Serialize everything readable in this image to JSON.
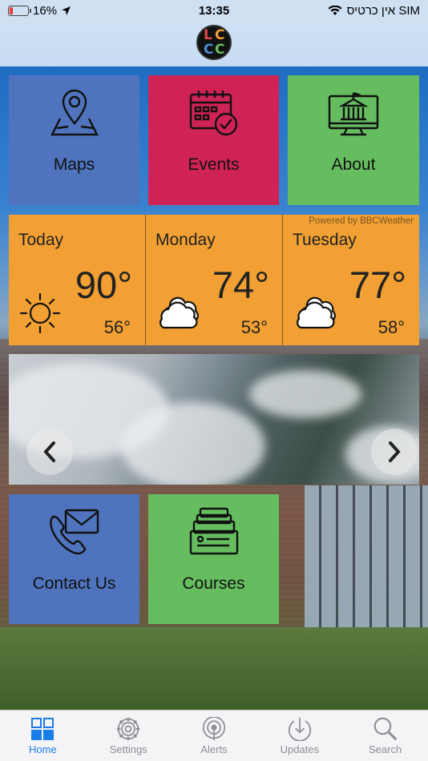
{
  "status_bar": {
    "battery": "16%",
    "battery_level": 0.16,
    "time": "13:35",
    "carrier": "אין כרטיס SIM"
  },
  "header": {
    "logo_letters": [
      "L",
      "C",
      "C",
      "C"
    ]
  },
  "tiles": {
    "maps": "Maps",
    "events": "Events",
    "about": "About",
    "contact": "Contact Us",
    "courses": "Courses"
  },
  "weather": {
    "powered_by": "Powered by BBCWeather",
    "days": [
      {
        "name": "Today",
        "high": "90°",
        "low": "56°",
        "icon": "sun-icon"
      },
      {
        "name": "Monday",
        "high": "74°",
        "low": "53°",
        "icon": "cloud-icon"
      },
      {
        "name": "Tuesday",
        "high": "77°",
        "low": "58°",
        "icon": "cloud-icon"
      }
    ]
  },
  "tabbar": {
    "items": [
      {
        "label": "Home",
        "icon": "grid-icon",
        "active": true
      },
      {
        "label": "Settings",
        "icon": "gear-icon",
        "active": false
      },
      {
        "label": "Alerts",
        "icon": "broadcast-icon",
        "active": false
      },
      {
        "label": "Updates",
        "icon": "download-icon",
        "active": false
      },
      {
        "label": "Search",
        "icon": "search-icon",
        "active": false
      }
    ]
  },
  "colors": {
    "blue_tile": "#4f74bd",
    "red_tile": "#d02355",
    "green_tile": "#66bd60",
    "weather": "#f2a033",
    "tab_active": "#1a7ce8"
  }
}
